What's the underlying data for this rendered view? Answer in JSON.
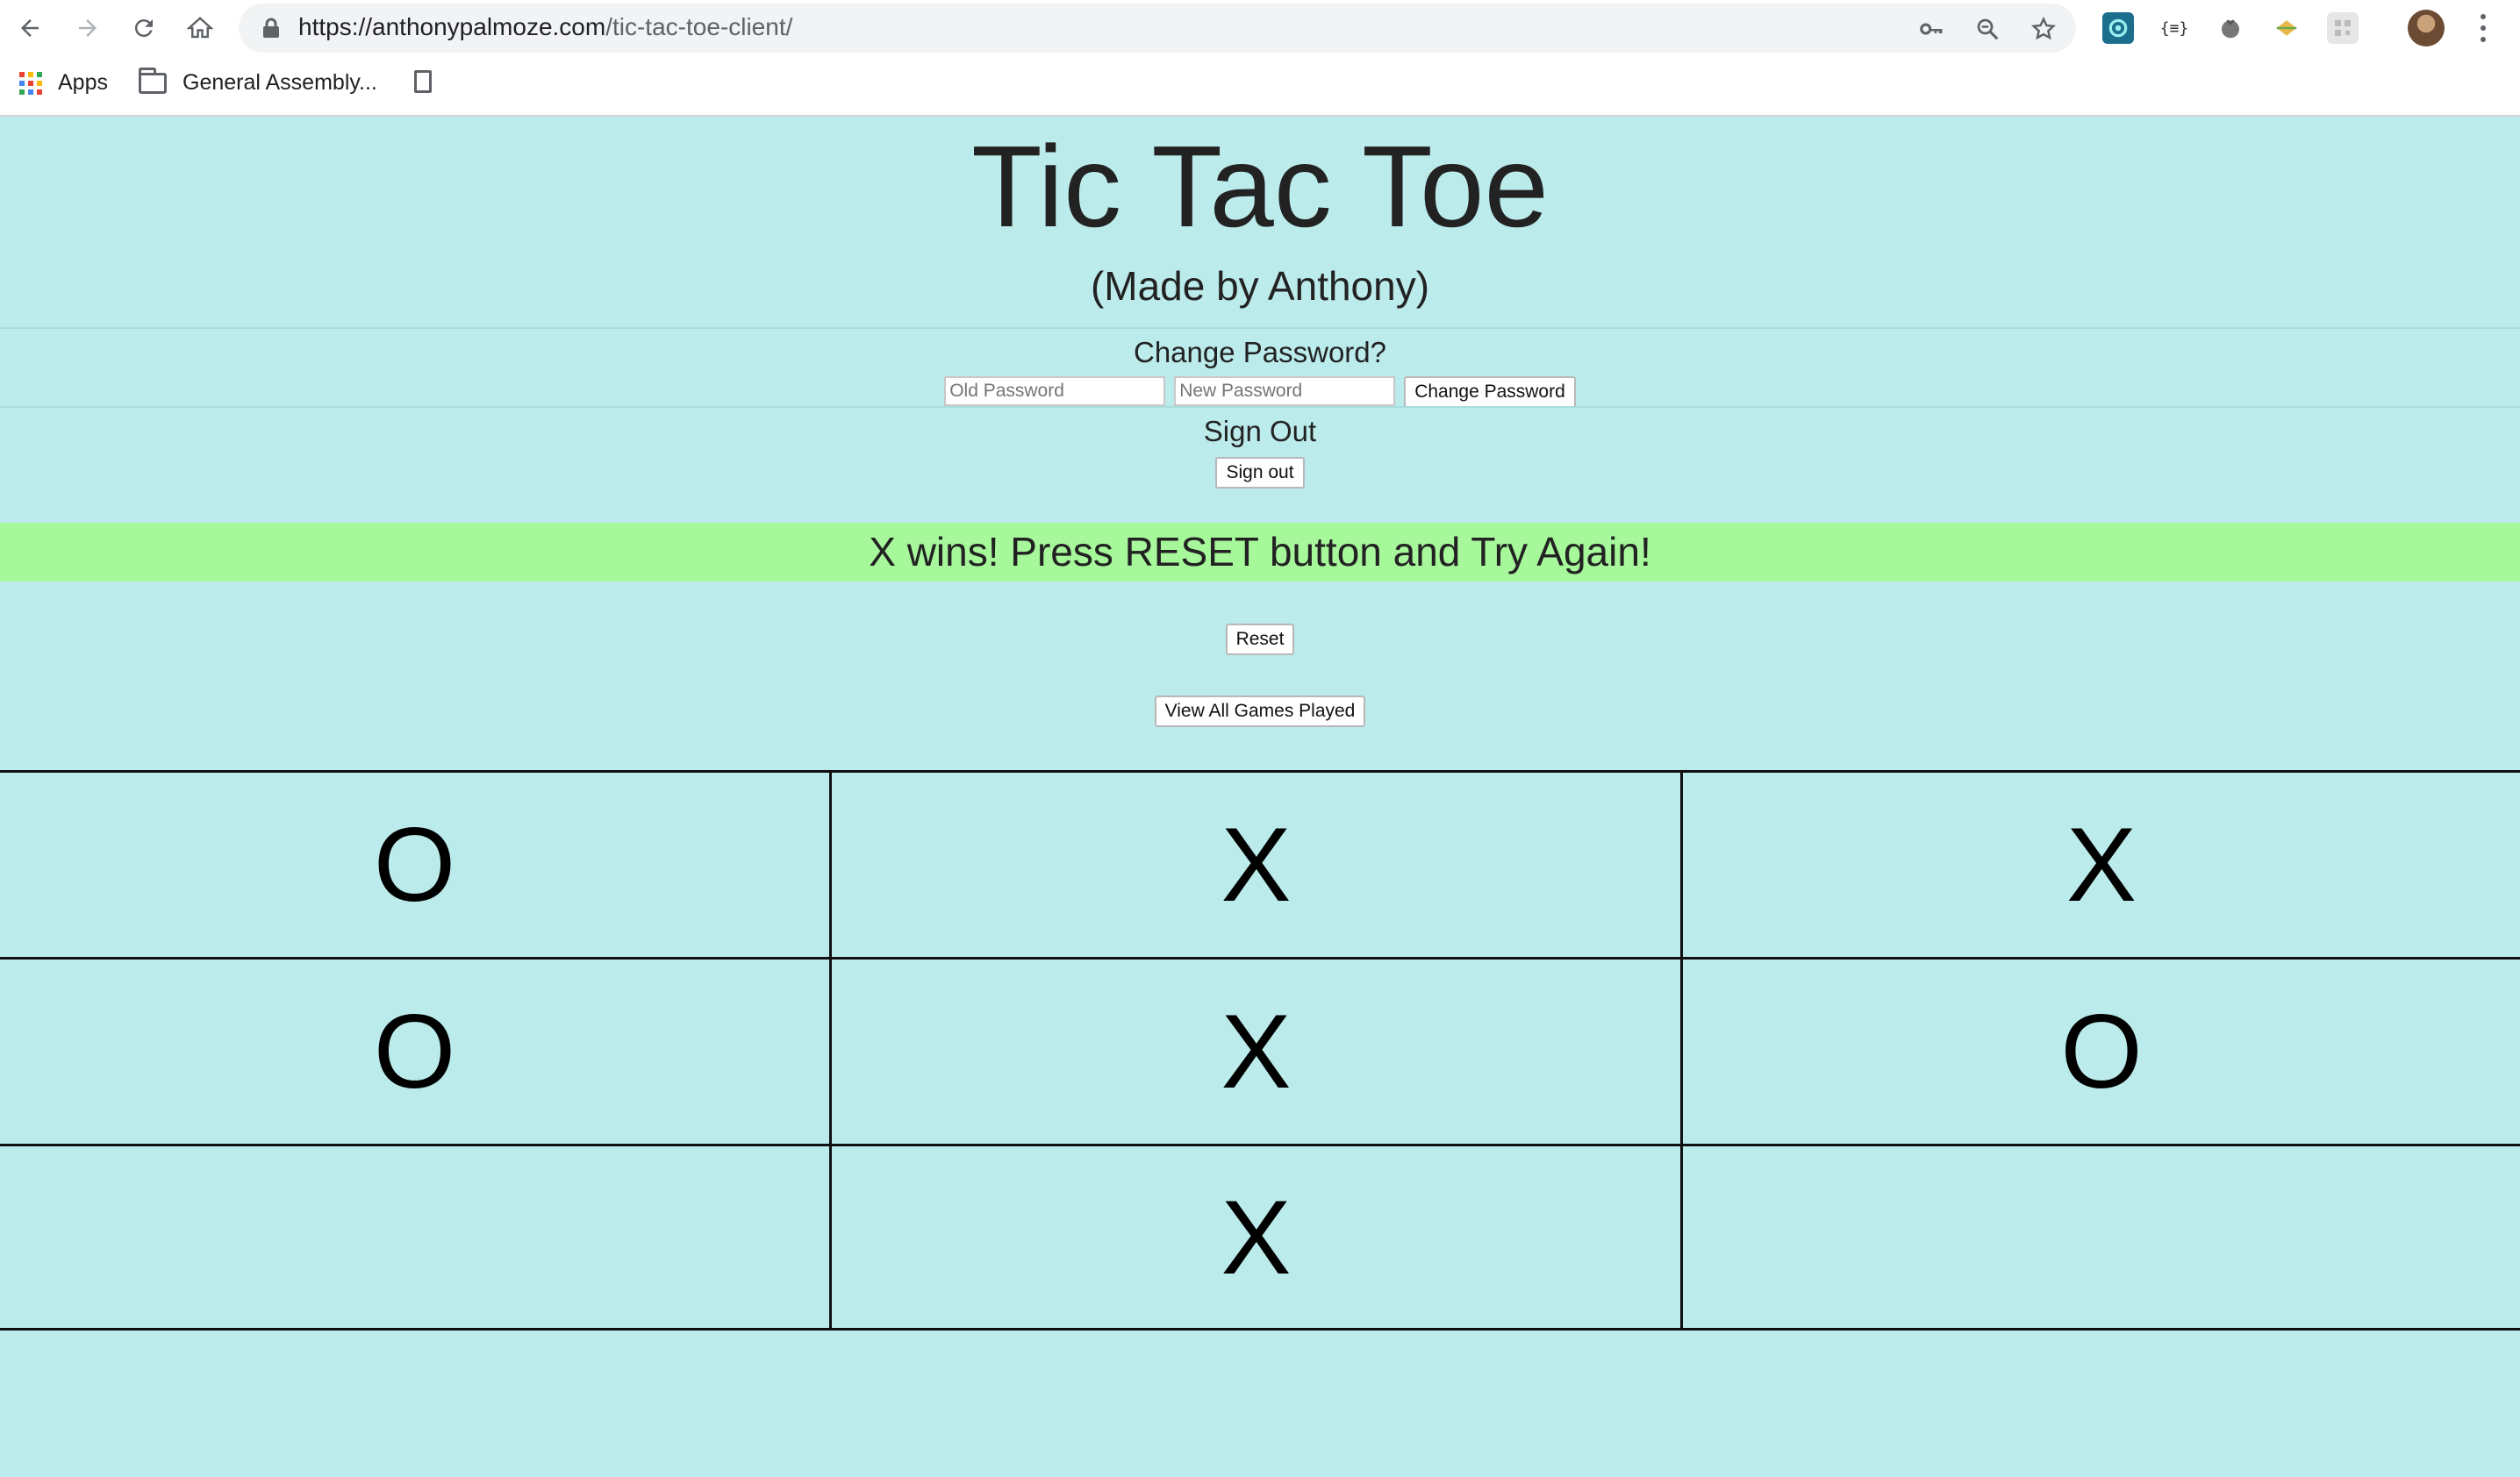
{
  "browser": {
    "url_host": "https://anthonypalmoze.com",
    "url_path": "/tic-tac-toe-client/",
    "bookmarks": [
      {
        "label": "Apps"
      },
      {
        "label": "General Assembly..."
      }
    ],
    "icons": {
      "back": "back-arrow-icon",
      "forward": "forward-arrow-icon",
      "reload": "reload-icon",
      "home": "home-icon",
      "lock": "lock-icon",
      "key": "key-icon",
      "zoom": "zoom-icon",
      "star": "star-icon"
    }
  },
  "header": {
    "title": "Tic Tac Toe",
    "subtitle": "(Made by Anthony)"
  },
  "change_password": {
    "heading": "Change Password?",
    "old_placeholder": "Old Password",
    "new_placeholder": "New Password",
    "button_label": "Change Password"
  },
  "sign_out": {
    "heading": "Sign Out",
    "button_label": "Sign out"
  },
  "game": {
    "status_message": "X wins! Press RESET button and Try Again!",
    "reset_label": "Reset",
    "view_all_label": "View All Games Played",
    "board": [
      "O",
      "X",
      "X",
      "O",
      "X",
      "O",
      "",
      "X",
      ""
    ]
  },
  "colors": {
    "page_background": "#bcebec",
    "status_banner": "#a6f89a",
    "grid_lines": "#111111"
  }
}
